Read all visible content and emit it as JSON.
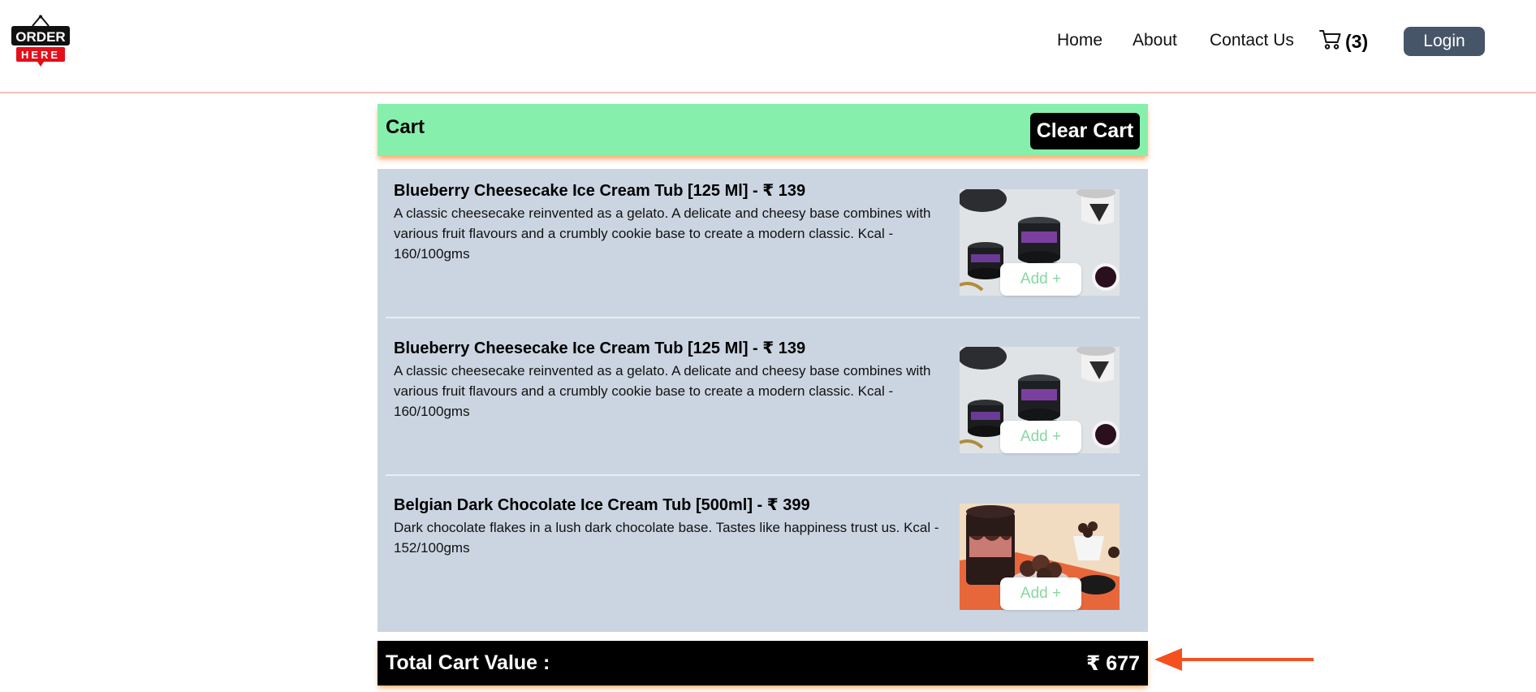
{
  "header": {
    "logo": {
      "line1": "ORDER",
      "line2": "HERE"
    },
    "nav": {
      "home": "Home",
      "about": "About",
      "contact": "Contact Us",
      "cart_count": "(3)",
      "login": "Login"
    }
  },
  "cart": {
    "title": "Cart",
    "clear_label": "Clear Cart",
    "add_label": "Add +",
    "items": [
      {
        "title": "Blueberry Cheesecake Ice Cream Tub [125 Ml] - ₹ 139",
        "description": "A classic cheesecake reinvented as a gelato. A delicate and cheesy base combines with various fruit flavours and a crumbly cookie base to create a modern classic. Kcal - 160/100gms",
        "image": "blueberry-cheesecake-tub-photo"
      },
      {
        "title": "Blueberry Cheesecake Ice Cream Tub [125 Ml] - ₹ 139",
        "description": "A classic cheesecake reinvented as a gelato. A delicate and cheesy base combines with various fruit flavours and a crumbly cookie base to create a modern classic. Kcal - 160/100gms",
        "image": "blueberry-cheesecake-tub-photo"
      },
      {
        "title": "Belgian Dark Chocolate Ice Cream Tub [500ml] - ₹ 399",
        "description": "Dark chocolate flakes in a lush dark chocolate base. Tastes like happiness trust us. Kcal - 152/100gms",
        "image": "belgian-dark-chocolate-tub-photo"
      }
    ],
    "total_label": "Total Cart Value :",
    "total_value": "₹ 677"
  },
  "colors": {
    "cart_header_bg": "#86efac",
    "items_bg": "#cbd5e1",
    "login_bg": "#475569",
    "accent_shadow": "#fb923c",
    "arrow": "#f4511e",
    "add_text": "#86d9a0"
  },
  "icons": {
    "cart": "shopping-cart-icon",
    "annotation": "arrow-left-icon"
  }
}
